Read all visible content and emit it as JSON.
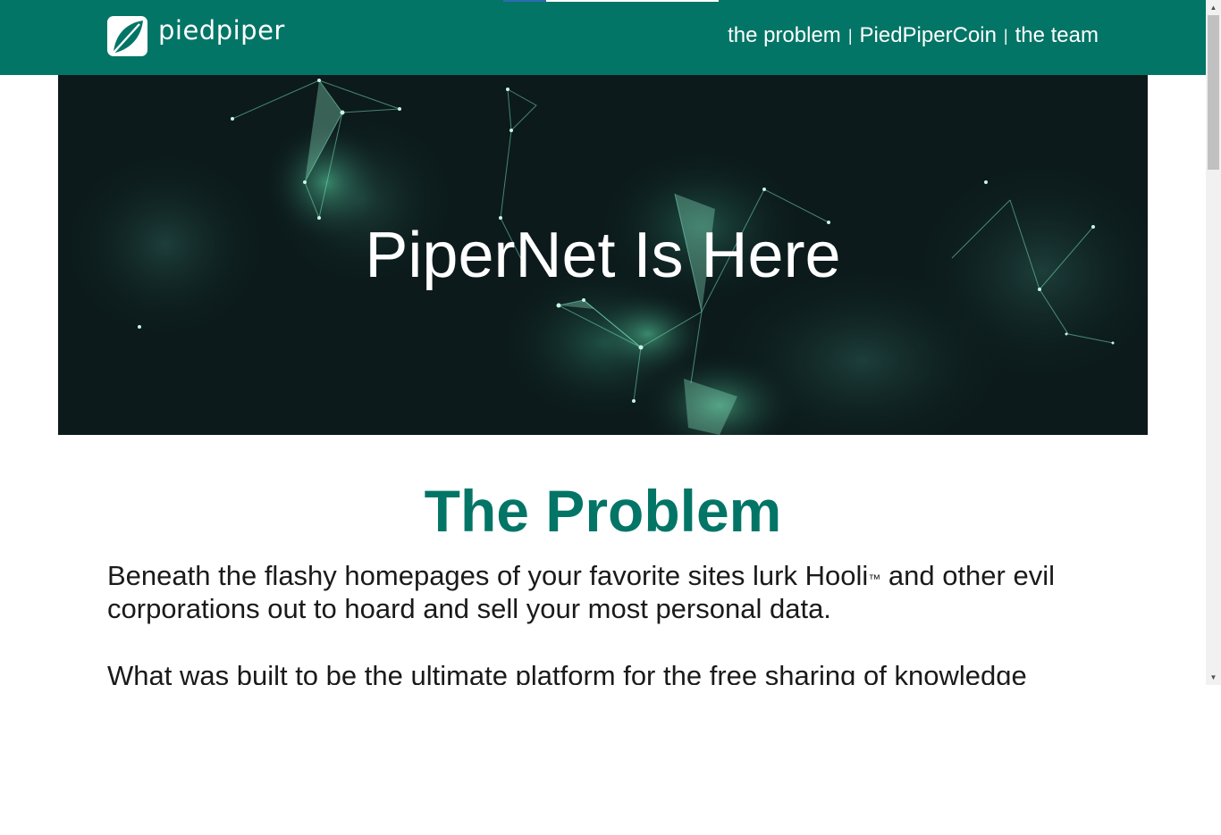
{
  "brand": {
    "name": "piedpiper",
    "logo_icon": "leaf-icon",
    "primary_color": "#037566"
  },
  "nav": {
    "items": [
      {
        "label": "the problem"
      },
      {
        "label": "PiedPiperCoin"
      },
      {
        "label": "the team"
      }
    ],
    "separator": "|"
  },
  "hero": {
    "title": "PiperNet Is Here"
  },
  "problem": {
    "title": "The Problem",
    "p1_before": "Beneath the flashy homepages of your favorite sites lurk Hooli",
    "p1_tm": "™",
    "p1_after": " and other evil corporations out to hoard and sell your most personal data.",
    "p2": "What was built to be the ultimate platform for the free sharing of knowledge"
  },
  "scrollbar": {
    "up_icon": "scroll-up-arrow-icon",
    "down_icon": "scroll-down-arrow-icon"
  }
}
